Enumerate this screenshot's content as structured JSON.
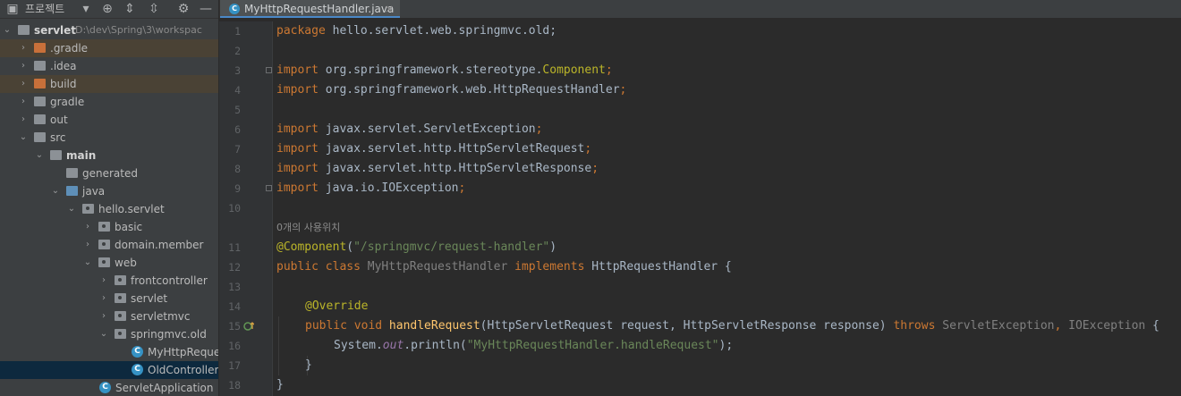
{
  "sidebar": {
    "title": "프로젝트",
    "tree": [
      {
        "label": "servlet",
        "path": "D:\\dev\\Spring\\3\\workspac"
      },
      {
        "label": ".gradle"
      },
      {
        "label": ".idea"
      },
      {
        "label": "build"
      },
      {
        "label": "gradle"
      },
      {
        "label": "out"
      },
      {
        "label": "src"
      },
      {
        "label": "main"
      },
      {
        "label": "generated"
      },
      {
        "label": "java"
      },
      {
        "label": "hello.servlet"
      },
      {
        "label": "basic"
      },
      {
        "label": "domain.member"
      },
      {
        "label": "web"
      },
      {
        "label": "frontcontroller"
      },
      {
        "label": "servlet"
      },
      {
        "label": "servletmvc"
      },
      {
        "label": "springmvc.old"
      },
      {
        "label": "MyHttpReques"
      },
      {
        "label": "OldController"
      },
      {
        "label": "ServletApplication"
      }
    ]
  },
  "tab": {
    "label": "MyHttpRequestHandler.java",
    "icon": "class-icon",
    "close": "×"
  },
  "editor": {
    "line_numbers": [
      "1",
      "2",
      "3",
      "4",
      "5",
      "6",
      "7",
      "8",
      "9",
      "10",
      "11",
      "12",
      "13",
      "14",
      "15",
      "16",
      "17",
      "18"
    ],
    "usage_hint": "0개의 사용위치",
    "code": {
      "l1": {
        "kw": "package",
        "rest": " hello.servlet.web.springmvc.old;"
      },
      "l3": {
        "kw": "import",
        "pkg": " org.springframework.stereotype.",
        "cls": "Component",
        "end": ";"
      },
      "l4": {
        "kw": "import",
        "rest": " org.springframework.web.HttpRequestHandler",
        "end": ";"
      },
      "l6": {
        "kw": "import",
        "rest": " javax.servlet.ServletException",
        "end": ";"
      },
      "l7": {
        "kw": "import",
        "rest": " javax.servlet.http.HttpServletRequest",
        "end": ";"
      },
      "l8": {
        "kw": "import",
        "rest": " javax.servlet.http.HttpServletResponse",
        "end": ";"
      },
      "l9": {
        "kw": "import",
        "rest": " java.io.IOException",
        "end": ";"
      },
      "l11": {
        "ann": "@Component",
        "open": "(",
        "str": "\"/springmvc/request-handler\"",
        "close": ")"
      },
      "l12": {
        "kw1": "public class ",
        "name": "MyHttpRequestHandler",
        "kw2": " implements ",
        "iface": "HttpRequestHandler",
        "brace": " {"
      },
      "l14": {
        "ann": "@Override"
      },
      "l15": {
        "kw1": "public void ",
        "method": "handleRequest",
        "params": "(HttpServletRequest request, HttpServletResponse response) ",
        "kw2": "throws ",
        "ex1": "ServletException",
        "sep": ", ",
        "ex2": "IOException",
        "brace": " {"
      },
      "l16": {
        "obj": "System.",
        "field": "out",
        "call": ".println(",
        "str": "\"MyHttpRequestHandler.handleRequest\"",
        "end": ");"
      },
      "l17": {
        "brace": "}"
      },
      "l18": {
        "brace": "}"
      }
    }
  },
  "colors": {
    "keyword": "#cc7832",
    "annotation": "#bbb529",
    "string": "#6a8759",
    "method": "#ffc66d",
    "static_field": "#9876aa",
    "selection": "#0d293e"
  }
}
